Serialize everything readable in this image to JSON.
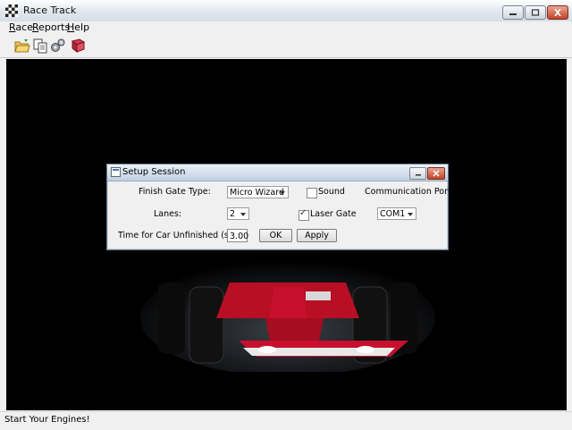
{
  "window": {
    "title": "Race Track"
  },
  "menu": {
    "items": [
      {
        "label": "Race",
        "mnemonic": "R",
        "rest": "ace"
      },
      {
        "label": "Reports",
        "mnemonic": "R",
        "rest": "eports"
      },
      {
        "label": "Help",
        "mnemonic": "H",
        "rest": "elp"
      }
    ]
  },
  "toolbar": {
    "icons": [
      "open-folder-icon",
      "copy-icon",
      "gears-icon",
      "book-icon"
    ]
  },
  "dialog": {
    "title": "Setup Session",
    "finish_gate_label": "Finish Gate Type:",
    "finish_gate_value": "Micro Wizard",
    "sound_label": "Sound",
    "sound_checked": false,
    "comm_port_label": "Communication Port:",
    "lanes_label": "Lanes:",
    "lanes_value": "2",
    "laser_gate_label": "Laser Gate",
    "laser_gate_checked": true,
    "comm_port_value": "COM1",
    "unfinished_label": "Time for Car Unfinished (sec)",
    "unfinished_value": "3.00",
    "ok_label": "OK",
    "apply_label": "Apply"
  },
  "status": {
    "text": "Start Your Engines!"
  },
  "colors": {
    "canvas_bg": "#000000",
    "car_red": "#c8102e"
  }
}
